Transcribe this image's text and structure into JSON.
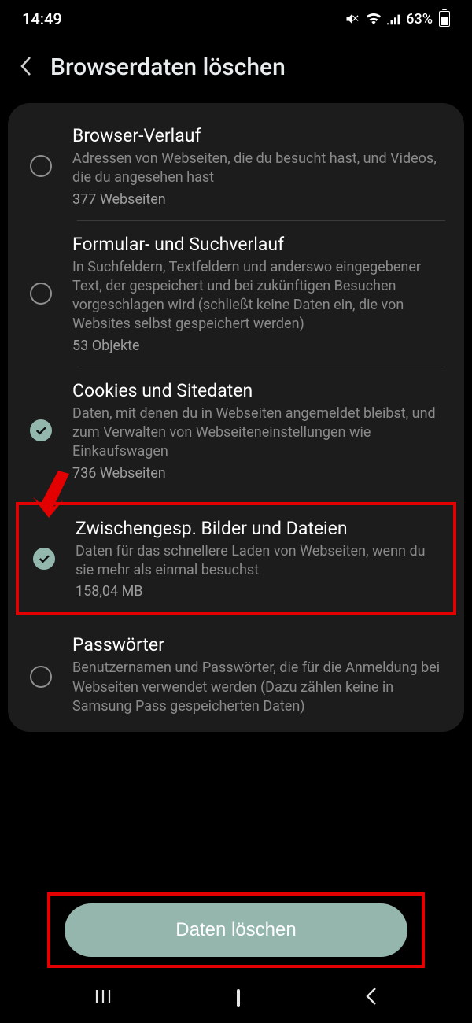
{
  "status": {
    "time": "14:49",
    "battery": "63%"
  },
  "header": {
    "title": "Browserdaten löschen"
  },
  "items": [
    {
      "title": "Browser-Verlauf",
      "desc": "Adressen von Webseiten, die du besucht hast, und Videos, die du angesehen hast",
      "count": "377 Webseiten",
      "checked": false
    },
    {
      "title": "Formular- und Suchverlauf",
      "desc": "In Suchfeldern, Textfeldern und anderswo eingegebener Text, der gespeichert und bei zukünftigen Besuchen vorgeschlagen wird (schließt keine Daten ein, die von Websites selbst gespeichert werden)",
      "count": "53 Objekte",
      "checked": false
    },
    {
      "title": "Cookies und Sitedaten",
      "desc": "Daten, mit denen du in Webseiten angemeldet bleibst, und zum Verwalten von Webseiteneinstellungen wie Einkaufswagen",
      "count": "736 Webseiten",
      "checked": true
    },
    {
      "title": "Zwischengesp. Bilder und Dateien",
      "desc": "Daten für das schnellere Laden von Webseiten, wenn du sie mehr als einmal besuchst",
      "count": "158,04 MB",
      "checked": true
    },
    {
      "title": "Passwörter",
      "desc": "Benutzernamen und Passwörter, die für die Anmeldung bei Webseiten verwendet werden (Dazu zählen keine in Samsung Pass gespeicherten Daten)",
      "count": "",
      "checked": false
    }
  ],
  "action": {
    "label": "Daten löschen"
  }
}
